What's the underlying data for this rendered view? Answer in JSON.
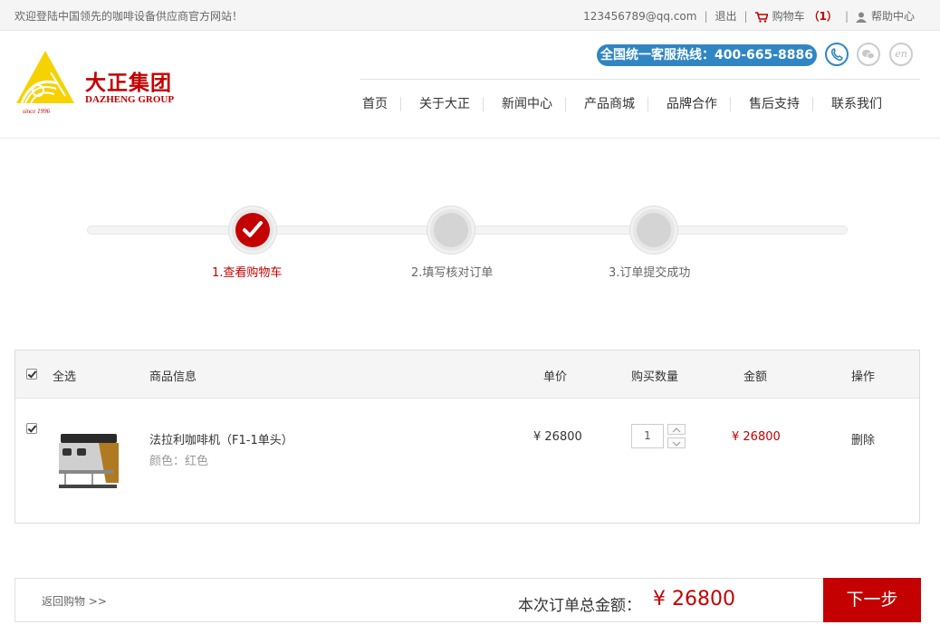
{
  "topbar": {
    "welcome": "欢迎登陆中国领先的咖啡设备供应商官方网站！",
    "email": "123456789@qq.com",
    "logout": "退出",
    "cart_label": "购物车",
    "cart_count": "（1）",
    "help": "帮助中心"
  },
  "header": {
    "brand_cn": "大正集团",
    "brand_en": "DAZHENG GROUP",
    "since": "since 1996",
    "hotline": "全国统一客服热线：400-665-8886",
    "en_label": "en",
    "nav": [
      "首页",
      "关于大正",
      "新闻中心",
      "产品商城",
      "品牌合作",
      "售后支持",
      "联系我们"
    ]
  },
  "steps": [
    {
      "label": "1.查看购物车",
      "active": true
    },
    {
      "label": "2.填写核对订单",
      "active": false
    },
    {
      "label": "3.订单提交成功",
      "active": false
    }
  ],
  "cart": {
    "headers": {
      "select_all": "全选",
      "product": "商品信息",
      "unit_price": "单价",
      "quantity": "购买数量",
      "amount": "金额",
      "action": "操作"
    },
    "items": [
      {
        "name": "法拉利咖啡机（F1-1单头）",
        "spec": "颜色：红色",
        "unit_price": "¥ 26800",
        "quantity": "1",
        "amount": "¥ 26800",
        "action": "删除"
      }
    ]
  },
  "footer": {
    "back": "返回购物 >>",
    "total_label": "本次订单总金额：",
    "total_value": "¥ 26800",
    "next": "下一步"
  },
  "colors": {
    "accent": "#c40000",
    "hotline_blue": "#2f86c3"
  }
}
